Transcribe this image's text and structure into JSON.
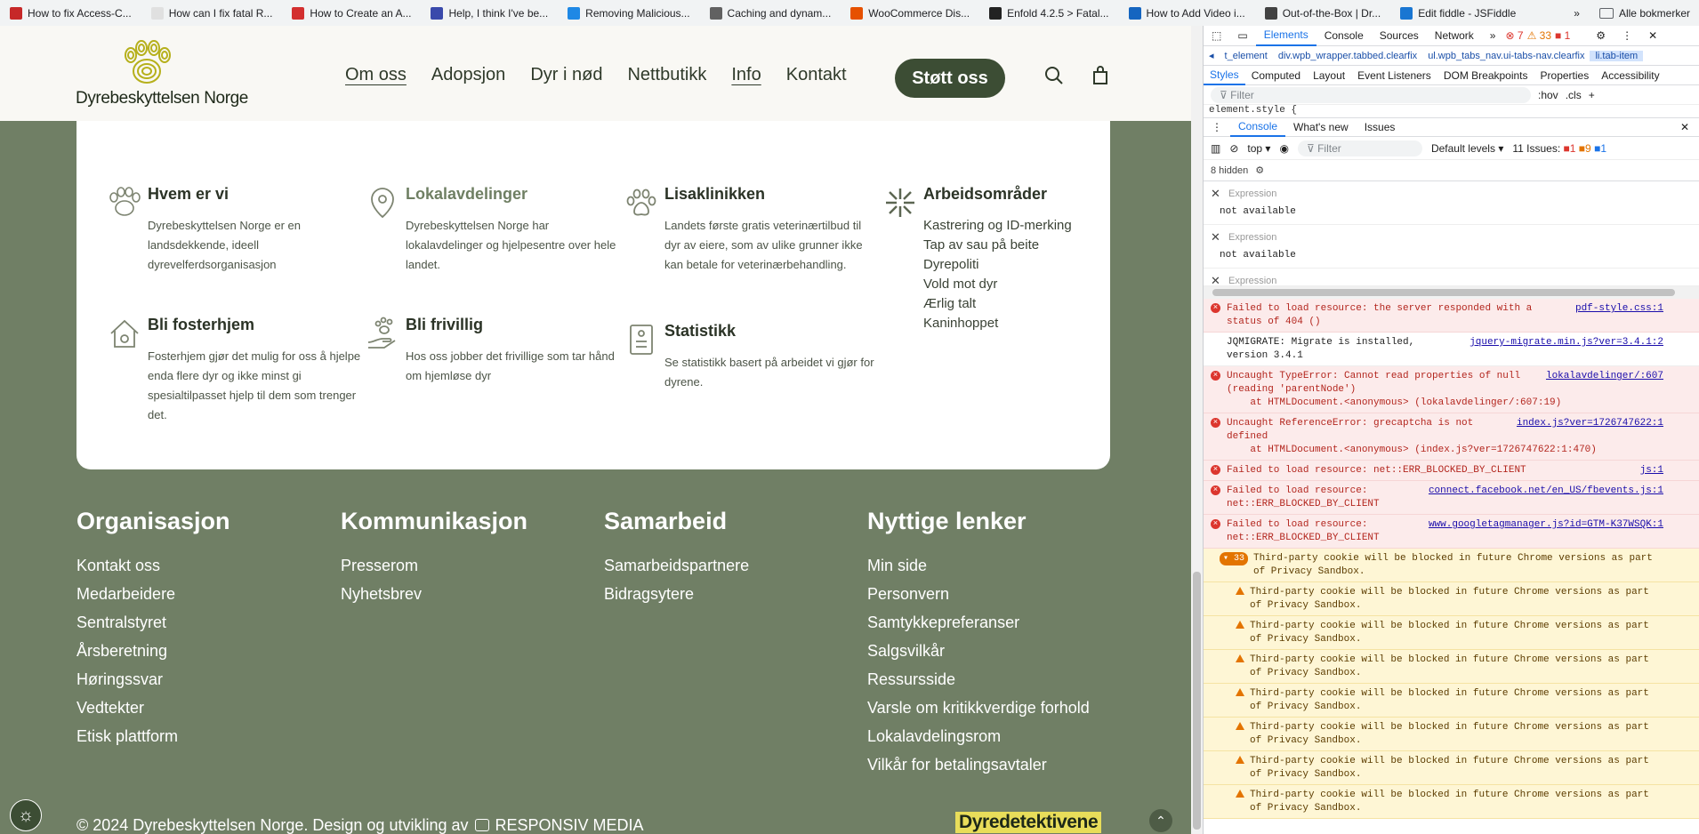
{
  "bookmarks": [
    {
      "label": "How to fix Access-C...",
      "color": "#c62828"
    },
    {
      "label": "How can I fix fatal R...",
      "color": "#e0e0e0"
    },
    {
      "label": "How to Create an A...",
      "color": "#d32f2f"
    },
    {
      "label": "Help, I think I've be...",
      "color": "#3949ab"
    },
    {
      "label": "Removing Malicious...",
      "color": "#1e88e5"
    },
    {
      "label": "Caching and dynam...",
      "color": "#616161"
    },
    {
      "label": "WooCommerce Dis...",
      "color": "#e65100"
    },
    {
      "label": "Enfold 4.2.5 > Fatal...",
      "color": "#222222"
    },
    {
      "label": "How to Add Video i...",
      "color": "#1565c0"
    },
    {
      "label": "Out-of-the-Box | Dr...",
      "color": "#424242"
    },
    {
      "label": "Edit fiddle - JSFiddle",
      "color": "#1976d2"
    }
  ],
  "bookmarks_more": "»",
  "bookmarks_folder": "Alle bokmerker",
  "site": {
    "logo_text": "Dyrebeskyttelsen Norge",
    "nav": [
      "Om oss",
      "Adopsjon",
      "Dyr i nød",
      "Nettbutikk",
      "Info",
      "Kontakt"
    ],
    "support_button": "Støtt oss",
    "mega": [
      {
        "title": "Hvem er vi",
        "text": "Dyrebeskyttelsen Norge er en landsdekkende, ideell dyrevelferdsorganisasjon"
      },
      {
        "title": "Lokalavdelinger",
        "text": "Dyrebeskyttelsen Norge har lokalavdelinger og hjelpesentre over hele landet."
      },
      {
        "title": "Lisaklinikken",
        "text": "Landets første gratis veterinærtilbud til dyr av eiere, som av ulike grunner ikke kan betale for veterinærbehandling."
      },
      {
        "title": "Arbeidsområder",
        "links": [
          "Kastrering og ID-merking",
          "Tap av sau på beite",
          "Dyrepoliti",
          "Vold mot dyr",
          "Ærlig talt",
          "Kaninhoppet"
        ]
      },
      {
        "title": "Bli fosterhjem",
        "text": "Fosterhjem gjør det mulig for oss å hjelpe enda flere dyr og ikke minst gi spesialtilpasset hjelp til dem som trenger det."
      },
      {
        "title": "Bli frivillig",
        "text": "Hos oss jobber det frivillige som tar hånd om hjemløse dyr"
      },
      {
        "title": "Statistikk",
        "text": "Se statistikk basert på arbeidet vi gjør for dyrene."
      }
    ],
    "footer": [
      {
        "title": "Organisasjon",
        "links": [
          "Kontakt oss",
          "Medarbeidere",
          "Sentralstyret",
          "Årsberetning",
          "Høringssvar",
          "Vedtekter",
          "Etisk plattform"
        ]
      },
      {
        "title": "Kommunikasjon",
        "links": [
          "Presserom",
          "Nyhetsbrev"
        ]
      },
      {
        "title": "Samarbeid",
        "links": [
          "Samarbeidspartnere",
          "Bidragsytere"
        ]
      },
      {
        "title": "Nyttige lenker",
        "links": [
          "Min side",
          "Personvern",
          "Samtykkepreferanser",
          "Salgsvilkår",
          "Ressursside",
          "Varsle om kritikkverdige forhold",
          "Lokalavdelingsrom",
          "Vilkår for betalingsavtaler"
        ]
      }
    ],
    "copyright": "© 2024 Dyrebeskyttelsen Norge. Design og utvikling av",
    "credit": "RESPONSIV MEDIA",
    "badge": "Dyredetektivene"
  },
  "devtools": {
    "tabs": [
      "Elements",
      "Console",
      "Sources",
      "Network"
    ],
    "errors": "7",
    "warnings": "33",
    "issues_badge": "1",
    "breadcrumbs": [
      "t_element",
      "div.wpb_wrapper.tabbed.clearfix",
      "ul.wpb_tabs_nav.ui-tabs-nav.clearfix",
      "li.tab-item"
    ],
    "subtabs": [
      "Styles",
      "Computed",
      "Layout",
      "Event Listeners",
      "DOM Breakpoints",
      "Properties",
      "Accessibility"
    ],
    "filter_placeholder": "Filter",
    "hov": ":hov",
    "cls": ".cls",
    "element_style": "element.style {",
    "drawer_tabs": [
      "Console",
      "What's new",
      "Issues"
    ],
    "context": "top",
    "levels": "Default levels",
    "issues_text": "11 Issues:",
    "issue_counts": [
      "1",
      "9",
      "1"
    ],
    "hidden": "8 hidden",
    "expressions": [
      {
        "placeholder": "Expression",
        "value": "not available"
      },
      {
        "placeholder": "Expression",
        "value": "not available"
      },
      {
        "placeholder": "Expression",
        "value": ""
      }
    ],
    "messages": [
      {
        "type": "err",
        "text": "Failed to load resource: the server responded with a\nstatus of 404 ()",
        "link": "pdf-style.css:1"
      },
      {
        "type": "info",
        "text": "JQMIGRATE: Migrate is installed,\nversion 3.4.1",
        "link": "jquery-migrate.min.js?ver=3.4.1:2"
      },
      {
        "type": "err",
        "text": "Uncaught TypeError: Cannot read properties of null\n(reading 'parentNode')\n    at HTMLDocument.<anonymous> (lokalavdelinger/:607:19)",
        "link": "lokalavdelinger/:607"
      },
      {
        "type": "err",
        "text": "Uncaught ReferenceError: grecaptcha is not\ndefined\n    at HTMLDocument.<anonymous> (index.js?ver=1726747622:1:470)",
        "link": "index.js?ver=1726747622:1"
      },
      {
        "type": "err",
        "text": "Failed to load resource: net::ERR_BLOCKED_BY_CLIENT",
        "link": "js:1"
      },
      {
        "type": "err",
        "text": "Failed to load resource:\nnet::ERR_BLOCKED_BY_CLIENT",
        "link": "connect.facebook.net/en_US/fbevents.js:1"
      },
      {
        "type": "err",
        "text": "Failed to load resource:\nnet::ERR_BLOCKED_BY_CLIENT",
        "link": "www.googletagmanager.js?id=GTM-K37WSQK:1"
      }
    ],
    "group_count": "33",
    "warning_text": "Third-party cookie will be blocked in future Chrome versions as part\nof Privacy Sandbox.",
    "warning_rows": 7
  }
}
